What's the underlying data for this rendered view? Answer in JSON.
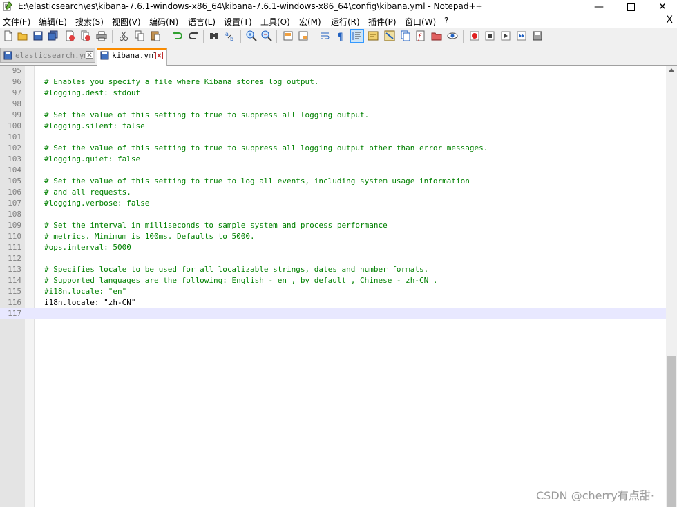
{
  "window": {
    "title": "E:\\elasticsearch\\es\\kibana-7.6.1-windows-x86_64\\kibana-7.6.1-windows-x86_64\\config\\kibana.yml - Notepad++",
    "minimize": "—",
    "close": "✕"
  },
  "menu": {
    "items": [
      "文件(F)",
      "编辑(E)",
      "搜索(S)",
      "视图(V)",
      "编码(N)",
      "语言(L)",
      "设置(T)",
      "工具(O)",
      "宏(M)",
      "运行(R)",
      "插件(P)",
      "窗口(W)",
      "?"
    ],
    "close": "X"
  },
  "tabs": [
    {
      "label": "elasticsearch.yml",
      "active": false
    },
    {
      "label": "kibana.yml",
      "active": true
    }
  ],
  "editor": {
    "lines": [
      {
        "num": "95",
        "text": "",
        "type": "plain"
      },
      {
        "num": "96",
        "text": "# Enables you specify a file where Kibana stores log output.",
        "type": "comment"
      },
      {
        "num": "97",
        "text": "#logging.dest: stdout",
        "type": "comment"
      },
      {
        "num": "98",
        "text": "",
        "type": "plain"
      },
      {
        "num": "99",
        "text": "# Set the value of this setting to true to suppress all logging output.",
        "type": "comment"
      },
      {
        "num": "100",
        "text": "#logging.silent: false",
        "type": "comment"
      },
      {
        "num": "101",
        "text": "",
        "type": "plain"
      },
      {
        "num": "102",
        "text": "# Set the value of this setting to true to suppress all logging output other than error messages.",
        "type": "comment"
      },
      {
        "num": "103",
        "text": "#logging.quiet: false",
        "type": "comment"
      },
      {
        "num": "104",
        "text": "",
        "type": "plain"
      },
      {
        "num": "105",
        "text": "# Set the value of this setting to true to log all events, including system usage information",
        "type": "comment"
      },
      {
        "num": "106",
        "text": "# and all requests.",
        "type": "comment"
      },
      {
        "num": "107",
        "text": "#logging.verbose: false",
        "type": "comment"
      },
      {
        "num": "108",
        "text": "",
        "type": "plain"
      },
      {
        "num": "109",
        "text": "# Set the interval in milliseconds to sample system and process performance",
        "type": "comment"
      },
      {
        "num": "110",
        "text": "# metrics. Minimum is 100ms. Defaults to 5000.",
        "type": "comment"
      },
      {
        "num": "111",
        "text": "#ops.interval: 5000",
        "type": "comment"
      },
      {
        "num": "112",
        "text": "",
        "type": "plain"
      },
      {
        "num": "113",
        "text": "# Specifies locale to be used for all localizable strings, dates and number formats.",
        "type": "comment"
      },
      {
        "num": "114",
        "text": "# Supported languages are the following: English - en , by default , Chinese - zh-CN .",
        "type": "comment"
      },
      {
        "num": "115",
        "text": "#i18n.locale: \"en\"",
        "type": "comment"
      },
      {
        "num": "116",
        "text": "i18n.locale: \"zh-CN\"",
        "type": "plain"
      },
      {
        "num": "117",
        "text": "",
        "type": "plain",
        "current": true
      }
    ]
  },
  "watermark": "CSDN @cherry有点甜·",
  "colors": {
    "comment": "#008000",
    "active_tab_accent": "#fa8b00",
    "current_line": "#e8e8ff",
    "caret": "#8000ff"
  },
  "toolbar_icons": [
    "new-file-icon",
    "open-file-icon",
    "save-icon",
    "save-all-icon",
    "close-icon",
    "close-all-icon",
    "print-icon",
    "cut-icon",
    "copy-icon",
    "paste-icon",
    "undo-icon",
    "redo-icon",
    "find-icon",
    "replace-icon",
    "zoom-in-icon",
    "zoom-out-icon",
    "sync-v-icon",
    "sync-h-icon",
    "word-wrap-icon",
    "show-all-chars-icon",
    "indent-guide-icon",
    "udl-icon",
    "doc-map-icon",
    "doc-list-icon",
    "function-list-icon",
    "folder-workspace-icon",
    "monitor-icon",
    "record-macro-icon",
    "stop-macro-icon",
    "play-macro-icon",
    "run-macro-multiple-icon",
    "save-macro-icon"
  ]
}
